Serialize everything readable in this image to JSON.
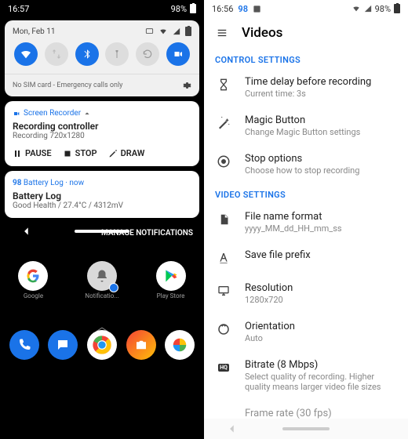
{
  "left": {
    "status": {
      "time": "16:57",
      "battery": "98%"
    },
    "shade": {
      "date": "Mon, Feb 11",
      "footer": "No SIM card - Emergency calls only"
    },
    "notif1": {
      "app": "Screen Recorder",
      "title": "Recording controller",
      "sub": "Recording 720x1280",
      "actions": {
        "pause": "PAUSE",
        "stop": "STOP",
        "draw": "DRAW"
      }
    },
    "notif2": {
      "app": "Battery Log · now",
      "appBadge": "98",
      "title": "Battery Log",
      "sub": "Good Health / 27.4°C / 4312mV"
    },
    "manage": "MANAGE NOTIFICATIONS",
    "apps": {
      "row1": [
        "Google",
        "Notificatio...",
        "Play Store"
      ],
      "dock": [
        "Phone",
        "Messages",
        "Chrome",
        "Camera",
        "Photos"
      ]
    }
  },
  "right": {
    "status": {
      "time": "16:56",
      "badge": "98",
      "battery": "98%"
    },
    "appbar": {
      "title": "Videos"
    },
    "sections": {
      "control": "CONTROL SETTINGS",
      "video": "VIDEO SETTINGS"
    },
    "settings": {
      "delay": {
        "t": "Time delay before recording",
        "s": "Current time: 3s"
      },
      "magic": {
        "t": "Magic Button",
        "s": "Change Magic Button settings"
      },
      "stop": {
        "t": "Stop options",
        "s": "Choose how to stop recording"
      },
      "filename": {
        "t": "File name format",
        "s": "yyyy_MM_dd_HH_mm_ss"
      },
      "prefix": {
        "t": "Save file prefix",
        "s": ""
      },
      "resolution": {
        "t": "Resolution",
        "s": "1280x720"
      },
      "orientation": {
        "t": "Orientation",
        "s": "Auto"
      },
      "bitrate": {
        "t": "Bitrate (8 Mbps)",
        "s": "Select quality of recording. Higher quality means larger video file sizes"
      },
      "framerate": {
        "t": "Frame rate (30 fps)",
        "s": ""
      }
    }
  }
}
